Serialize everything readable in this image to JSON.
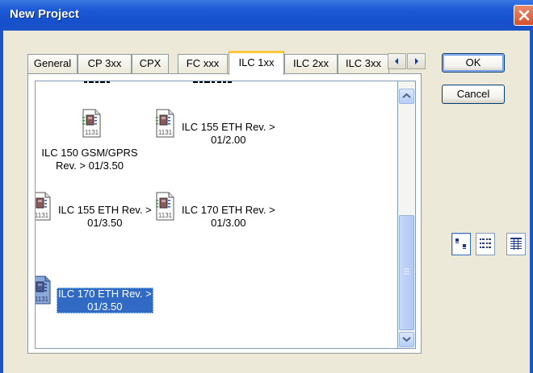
{
  "window": {
    "title": "New Project"
  },
  "tabs": [
    {
      "label": "General"
    },
    {
      "label": "CP 3xx"
    },
    {
      "label": "CPX"
    },
    {
      "label": "FC xxx"
    },
    {
      "label": "ILC 1xx"
    },
    {
      "label": "ILC 2xx"
    },
    {
      "label": "ILC 3xx"
    }
  ],
  "active_tab": "ILC 1xx",
  "items": [
    {
      "line1": "ILC 150 GSM/GPRS",
      "line2": "Rev. > 01/3.50",
      "selected": false
    },
    {
      "line1": "ILC 155 ETH Rev. >",
      "line2": "01/2.00",
      "selected": false
    },
    {
      "line1": "ILC 155 ETH Rev. >",
      "line2": "01/3.50",
      "selected": false
    },
    {
      "line1": "ILC 170 ETH Rev. >",
      "line2": "01/3.00",
      "selected": false
    },
    {
      "line1": "ILC 170 ETH Rev. >",
      "line2": "01/3.50",
      "selected": true
    }
  ],
  "icon_caption": "1131",
  "buttons": {
    "ok": "OK",
    "cancel": "Cancel"
  },
  "view_modes": [
    "large-icons",
    "list",
    "details"
  ],
  "active_view_mode": "large-icons",
  "colors": {
    "titlebar": "#1650cc",
    "selection": "#316ac5",
    "active_tab_accent": "#ffc83c"
  }
}
